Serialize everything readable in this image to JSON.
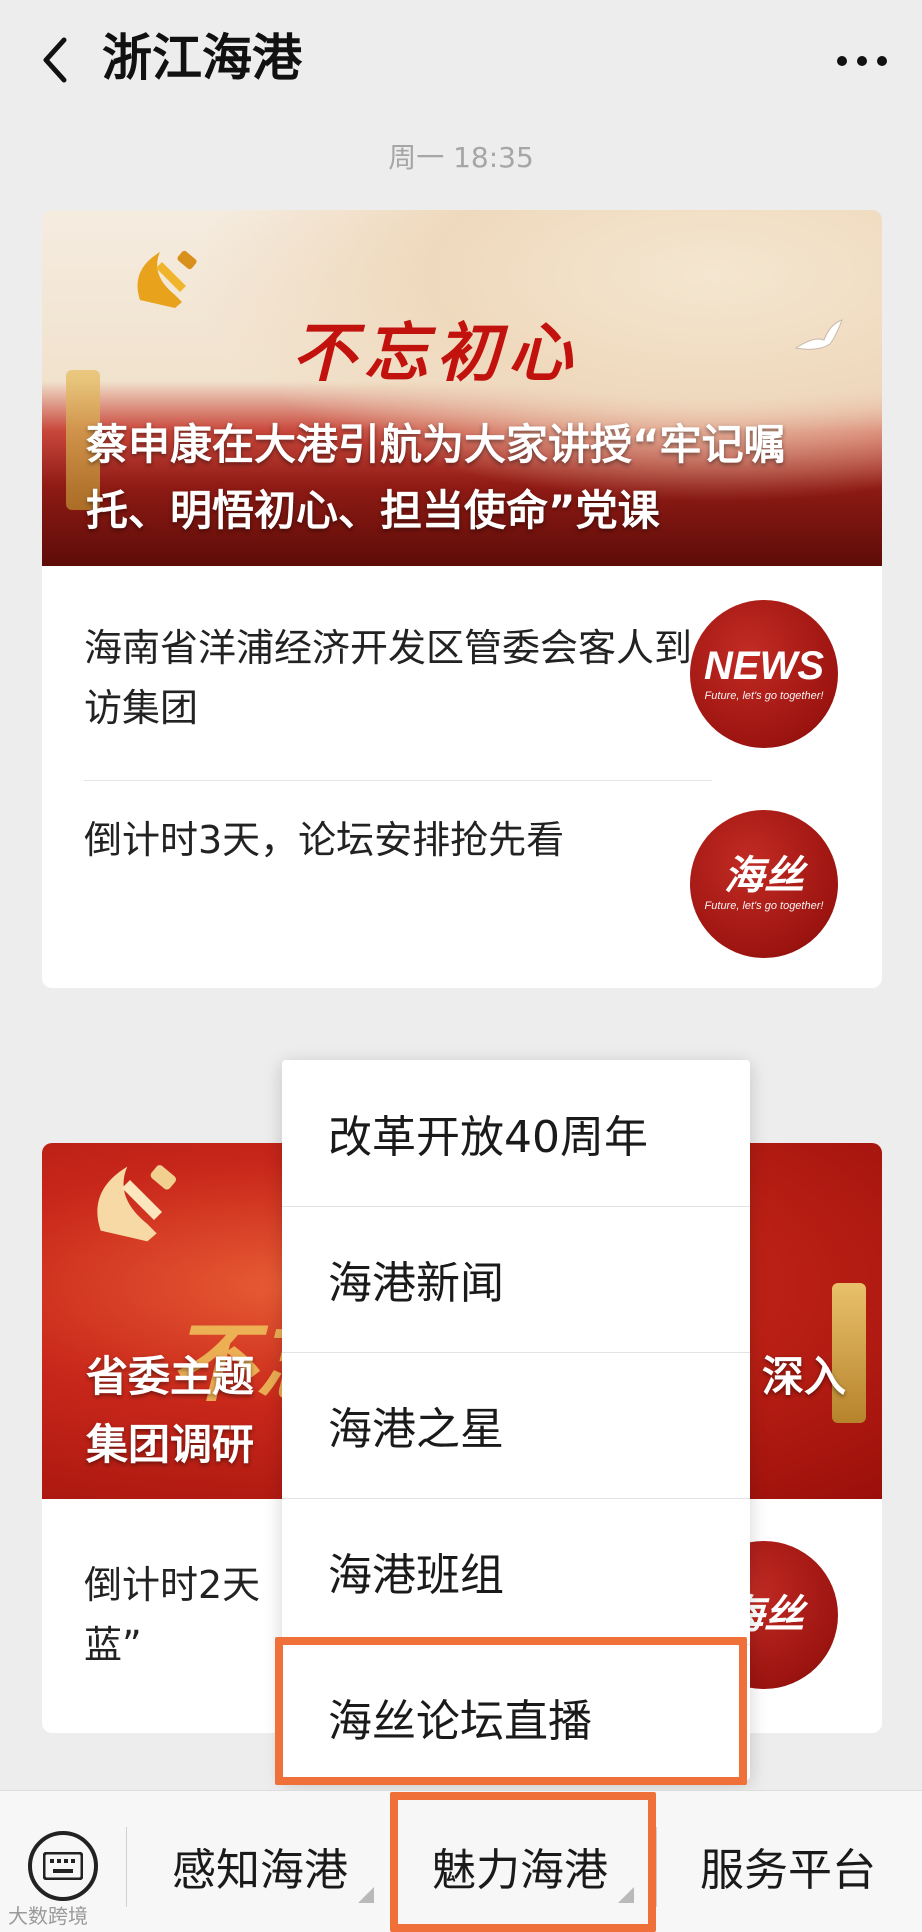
{
  "header": {
    "title": "浙江海港",
    "back_icon": "chevron-left-icon",
    "more_icon": "more-dots-icon"
  },
  "timestamp": "周一 18:35",
  "cards": [
    {
      "banner": {
        "slogan": "不忘初心",
        "title": "蔡申康在大港引航为大家讲授“牢记嘱托、明悟初心、担当使命”党课"
      },
      "items": [
        {
          "text": "海南省洋浦经济开发区管委会客人到访集团",
          "thumb_main": "NEWS",
          "thumb_sub": "Future, let's go together!"
        },
        {
          "text": "倒计时3天，论坛安排抢先看",
          "thumb_main": "海丝",
          "thumb_sub": "Future, let's go together!"
        }
      ]
    },
    {
      "banner": {
        "slogan": "不忘",
        "title_left": "省委主题",
        "title_right": "深入",
        "title_line2": "集团调研"
      },
      "items": [
        {
          "text_line1": "倒计时2天",
          "text_line2": "蓝”",
          "thumb_main": "海丝"
        }
      ]
    }
  ],
  "menu": {
    "items": [
      "改革开放40周年",
      "海港新闻",
      "海港之星",
      "海港班组",
      "海丝论坛直播"
    ],
    "highlight_color": "#f0703a"
  },
  "bottom_bar": {
    "keyboard_icon": "keyboard-icon",
    "tabs": [
      "感知海港",
      "魅力海港",
      "服务平台"
    ]
  },
  "watermark": "大数跨境"
}
